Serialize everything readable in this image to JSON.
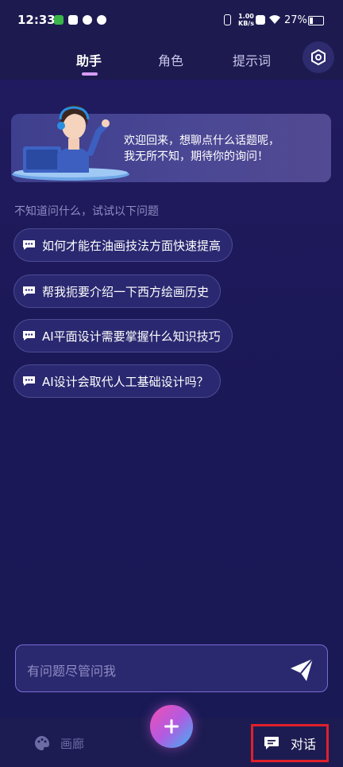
{
  "status_bar": {
    "time": "12:33",
    "net_speed": "1.00",
    "net_unit": "KB/s",
    "battery": "27%"
  },
  "tabs": [
    {
      "label": "助手",
      "active": true
    },
    {
      "label": "角色",
      "active": false
    },
    {
      "label": "提示词",
      "active": false
    }
  ],
  "welcome": {
    "line1": "欢迎回来，想聊点什么话题呢，",
    "line2": "我无所不知，期待你的询问！"
  },
  "hint": "不知道问什么，试试以下问题",
  "suggestions": [
    "如何才能在油画技法方面快速提高",
    "帮我扼要介绍一下西方绘画历史",
    "AI平面设计需要掌握什么知识技巧",
    "AI设计会取代人工基础设计吗？"
  ],
  "input": {
    "placeholder": "有问题尽管问我"
  },
  "bottom_nav": {
    "gallery_label": "画廊",
    "chat_label": "对话"
  },
  "colors": {
    "accent": "#d79cf4",
    "highlight_border": "#e0202a"
  }
}
